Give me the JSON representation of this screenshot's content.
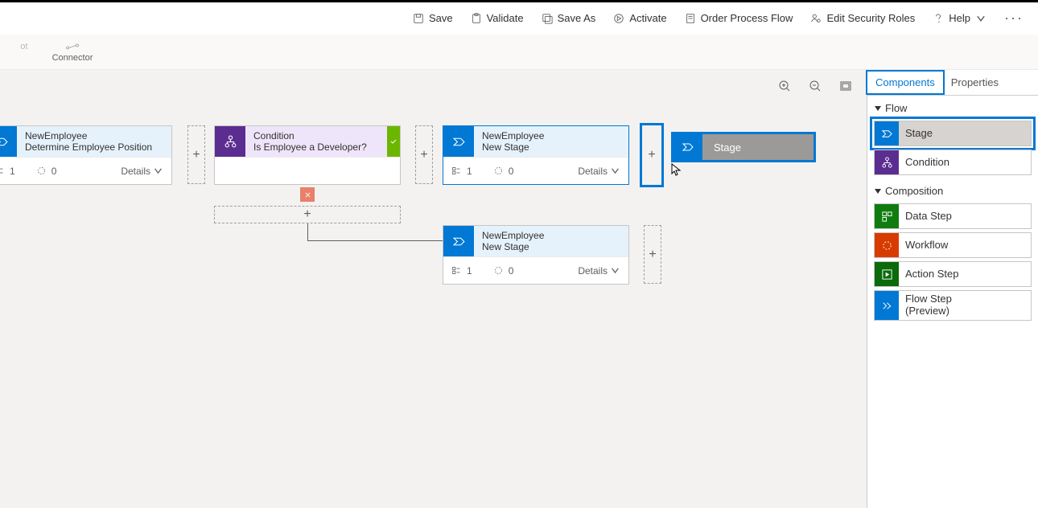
{
  "toolbar": {
    "save": "Save",
    "validate": "Validate",
    "save_as": "Save As",
    "activate": "Activate",
    "order": "Order Process Flow",
    "security": "Edit Security Roles",
    "help": "Help"
  },
  "secondrow": {
    "snapshot_label": "ot",
    "connector_label": "Connector"
  },
  "canvas": {
    "stage1_entity": "NewEmployee",
    "stage1_name": "Determine Employee Position",
    "condition_label": "Condition",
    "condition_name": "Is Employee a Developer?",
    "stage2_entity": "NewEmployee",
    "stage2_name": "New Stage",
    "stage3_entity": "NewEmployee",
    "stage3_name": "New Stage",
    "details_label": "Details",
    "steps_count_1": "1",
    "steps_count_0": "0",
    "drag_label": "Stage"
  },
  "rpanel": {
    "tab_components": "Components",
    "tab_properties": "Properties",
    "section_flow": "Flow",
    "section_composition": "Composition",
    "stage": "Stage",
    "condition": "Condition",
    "data_step": "Data Step",
    "workflow": "Workflow",
    "action_step": "Action Step",
    "flow_step": "Flow Step\n(Preview)"
  }
}
